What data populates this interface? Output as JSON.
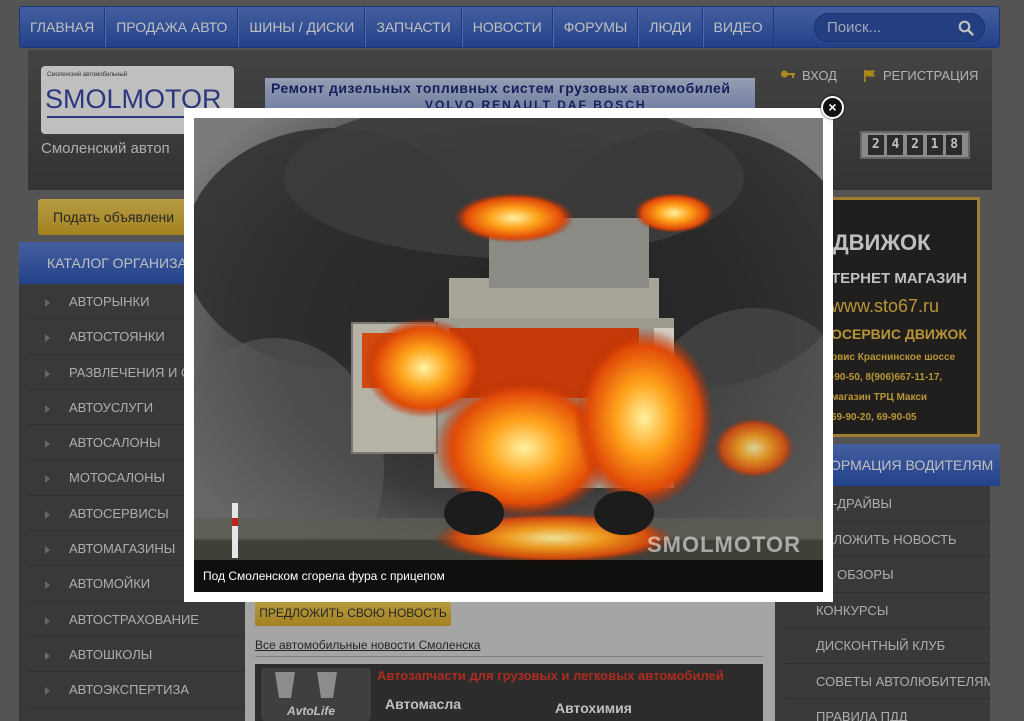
{
  "nav": {
    "items": [
      {
        "label": "ГЛАВНАЯ"
      },
      {
        "label": "ПРОДАЖА АВТО"
      },
      {
        "label": "ШИНЫ / ДИСКИ"
      },
      {
        "label": "ЗАПЧАСТИ"
      },
      {
        "label": "НОВОСТИ"
      },
      {
        "label": "ФОРУМЫ"
      },
      {
        "label": "ЛЮДИ"
      },
      {
        "label": "ВИДЕО"
      }
    ],
    "search_placeholder": "Поиск..."
  },
  "header": {
    "logo_small": "Смоленский автомобильный",
    "logo_text": "SMOLMOTOR",
    "tagline": "Смоленский автоп",
    "banner_title": "Ремонт дизельных топливных систем грузовых автомобилей",
    "banner_sub": "VOLVO  RENAULT  DAF    BOSCH",
    "login_label": "ВХОД",
    "register_label": "РЕГИСТРАЦИЯ",
    "counter_digits": [
      "2",
      "4",
      "2",
      "1",
      "8"
    ]
  },
  "left": {
    "post_ad_label": "Подать объявлени",
    "catalog_header": "КАТАЛОГ ОРГАНИЗА",
    "items": [
      {
        "label": "АВТОРЫНКИ"
      },
      {
        "label": "АВТОСТОЯНКИ"
      },
      {
        "label": "РАЗВЛЕЧЕНИЯ И СЕ"
      },
      {
        "label": "АВТОУСЛУГИ"
      },
      {
        "label": "АВТОСАЛОНЫ"
      },
      {
        "label": "МОТОСАЛОНЫ"
      },
      {
        "label": "АВТОСЕРВИСЫ"
      },
      {
        "label": "АВТОМАГАЗИНЫ"
      },
      {
        "label": "АВТОМОЙКИ"
      },
      {
        "label": "АВТОСТРАХОВАНИЕ"
      },
      {
        "label": "АВТОШКОЛЫ"
      },
      {
        "label": "АВТОЭКСПЕРТИЗА"
      }
    ]
  },
  "center": {
    "suggest_news_label": "ПРЕДЛОЖИТЬ СВОЮ НОВОСТЬ",
    "all_news_link": "Все автомобильные новости Смоленска",
    "banner_title": "Автозапчасти для грузовых и легковых автомобилей",
    "banner_logo": "AvtoLife",
    "banner_oils": "Автомасла",
    "banner_chem": "Автохимия"
  },
  "right": {
    "ad_brand": "ДВИЖОК",
    "ad_line1": "ТЕРНЕТ МАГАЗИН",
    "ad_site": "www.sto67.ru",
    "ad_service": "ОСЕРВИС ДВИЖОК",
    "ad_small1": "рвис Краснинское шоссе",
    "ad_small2": "-90-50, 8(906)667-11-17,",
    "ad_small3": "магазин ТРЦ Макси",
    "ad_small4": "69-90-20, 69-90-05",
    "info_header": "ОРМАЦИЯ ВОДИТЕЛЯМ",
    "items": [
      {
        "label": "СТ-ДРАЙВЫ"
      },
      {
        "label": "ЕДЛОЖИТЬ НОВОСТЬ"
      },
      {
        "label": "ТО ОБЗОРЫ"
      },
      {
        "label": "КОНКУРСЫ"
      },
      {
        "label": "ДИСКОНТНЫЙ КЛУБ"
      },
      {
        "label": "СОВЕТЫ АВТОЛЮБИТЕЛЯМ"
      },
      {
        "label": "ПРАВИЛА ПДД"
      }
    ]
  },
  "lightbox": {
    "caption": "Под Смоленском сгорела фура с прицепом",
    "watermark": "SMOLMOTOR",
    "close_symbol": "×"
  },
  "colors": {
    "nav_blue": "#2f58b8",
    "accent_yellow": "#f4d15a",
    "page_bg": "#707070"
  }
}
